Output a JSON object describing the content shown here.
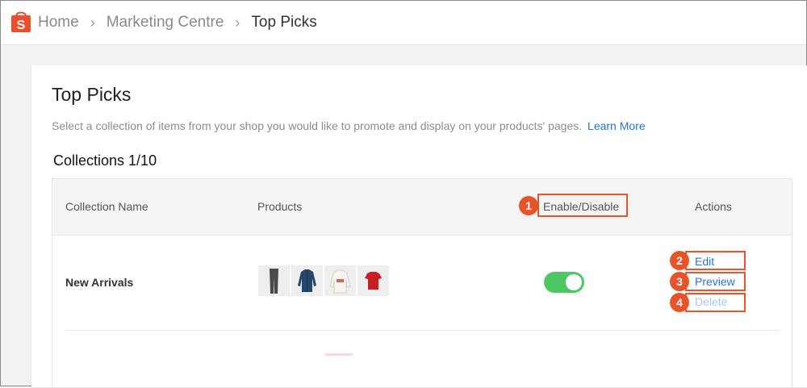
{
  "breadcrumb": {
    "home": "Home",
    "marketing": "Marketing Centre",
    "current": "Top Picks"
  },
  "page": {
    "title": "Top Picks",
    "description": "Select a collection of items from your shop you would like to promote and display on your products' pages.",
    "learn_more": "Learn More",
    "collections_count": "Collections 1/10"
  },
  "table": {
    "columns": {
      "name": "Collection Name",
      "products": "Products",
      "enable": "Enable/Disable",
      "actions": "Actions"
    },
    "rows": [
      {
        "name": "New Arrivals",
        "products": [
          "jeans",
          "denim-jacket",
          "hoodie",
          "red-t-shirt"
        ],
        "enabled": true,
        "actions": {
          "edit": "Edit",
          "preview": "Preview",
          "delete": "Delete"
        }
      }
    ]
  },
  "annotations": [
    "1",
    "2",
    "3",
    "4"
  ],
  "colors": {
    "brand": "#ee4d2d",
    "toggle_on": "#4cc764",
    "link": "#2673dd",
    "highlight": "#e8542a"
  }
}
